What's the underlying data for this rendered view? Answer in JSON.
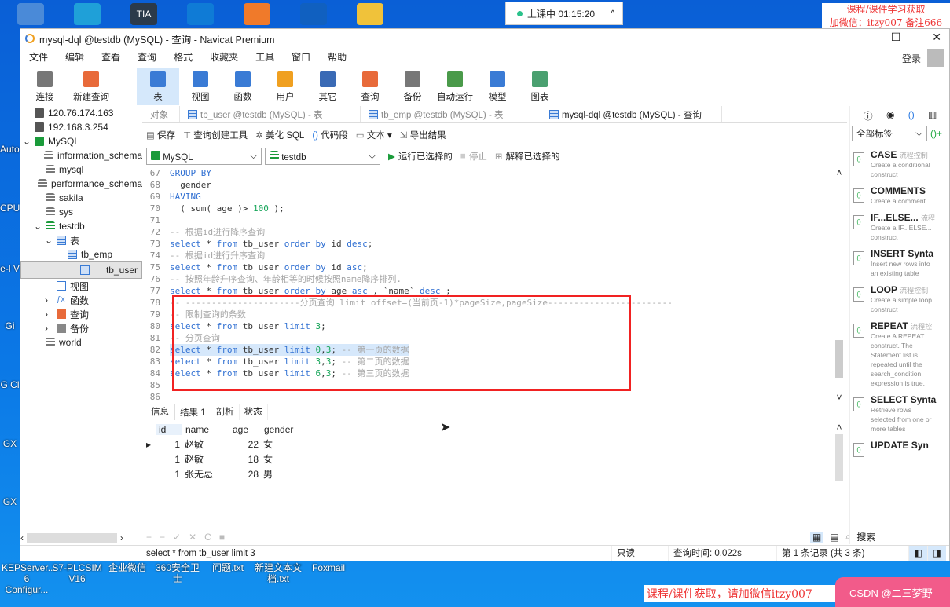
{
  "desktop": {
    "top_icons": [
      {
        "name": "computer",
        "color": "#4a8ad8"
      },
      {
        "name": "edge",
        "color": "#1fa0d8"
      },
      {
        "name": "tia-portal",
        "color": "#2b3a4a",
        "label": "TIA"
      },
      {
        "name": "app-a",
        "color": "#0f7bd6"
      },
      {
        "name": "app-colorful",
        "color": "#f07a2a"
      },
      {
        "name": "app-k",
        "color": "#1060c0"
      },
      {
        "name": "folder",
        "color": "#f0c23a"
      }
    ],
    "left_labels": [
      "Auto Lice",
      "CPU 设",
      "e-l V",
      "Gi",
      "G Cl",
      "GX",
      "GX"
    ],
    "bottom_labels": [
      "KEPServer... 6 Configur...",
      "S7-PLCSIM V16",
      "企业微信",
      "360安全卫士",
      "问题.txt",
      "新建文本文档.txt",
      "Foxmail"
    ],
    "timer": "上课中 01:15:20",
    "watermark_top": [
      "课程/课件学习获取",
      "加微信：itzy007 备注666"
    ],
    "watermark_bottom": "课程/课件获取，请加微信itzy007",
    "badge": "CSDN @二三梦野"
  },
  "window": {
    "title": "mysql-dql @testdb (MySQL) - 查询 - Navicat Premium",
    "login": "登录"
  },
  "menu": [
    "文件",
    "编辑",
    "查看",
    "查询",
    "格式",
    "收藏夹",
    "工具",
    "窗口",
    "帮助"
  ],
  "toolbar": [
    {
      "label": "连接",
      "color": "#777"
    },
    {
      "label": "新建查询",
      "color": "#e86a3a"
    },
    {
      "label": "表",
      "color": "#3a7bd5",
      "active": true
    },
    {
      "label": "视图",
      "color": "#3a7bd5"
    },
    {
      "label": "函数",
      "color": "#3a7bd5"
    },
    {
      "label": "用户",
      "color": "#f0a020"
    },
    {
      "label": "其它",
      "color": "#3a6ab5"
    },
    {
      "label": "查询",
      "color": "#e86a3a"
    },
    {
      "label": "备份",
      "color": "#777"
    },
    {
      "label": "自动运行",
      "color": "#4a9a4a"
    },
    {
      "label": "模型",
      "color": "#3a7bd5"
    },
    {
      "label": "图表",
      "color": "#4aa070"
    }
  ],
  "tree": [
    {
      "label": "120.76.174.163",
      "indent": 0,
      "icon": "conn"
    },
    {
      "label": "192.168.3.254",
      "indent": 0,
      "icon": "conn"
    },
    {
      "label": "MySQL",
      "indent": 0,
      "icon": "conn-green",
      "arrow": "v"
    },
    {
      "label": "information_schema",
      "indent": 1,
      "icon": "db"
    },
    {
      "label": "mysql",
      "indent": 1,
      "icon": "db"
    },
    {
      "label": "performance_schema",
      "indent": 1,
      "icon": "db"
    },
    {
      "label": "sakila",
      "indent": 1,
      "icon": "db"
    },
    {
      "label": "sys",
      "indent": 1,
      "icon": "db"
    },
    {
      "label": "testdb",
      "indent": 1,
      "icon": "db-green",
      "arrow": "v"
    },
    {
      "label": "表",
      "indent": 2,
      "icon": "table",
      "arrow": "v"
    },
    {
      "label": "tb_emp",
      "indent": 3,
      "icon": "table"
    },
    {
      "label": "tb_user",
      "indent": 3,
      "icon": "table",
      "selected": true
    },
    {
      "label": "视图",
      "indent": 2,
      "icon": "view"
    },
    {
      "label": "函数",
      "indent": 2,
      "icon": "fx",
      "arrow": ">"
    },
    {
      "label": "查询",
      "indent": 2,
      "icon": "query",
      "arrow": ">"
    },
    {
      "label": "备份",
      "indent": 2,
      "icon": "backup",
      "arrow": ">"
    },
    {
      "label": "world",
      "indent": 1,
      "icon": "db"
    }
  ],
  "tabs": [
    {
      "label": "对象"
    },
    {
      "label": "tb_user @testdb (MySQL) - 表"
    },
    {
      "label": "tb_emp @testdb (MySQL) - 表"
    },
    {
      "label": "mysql-dql @testdb (MySQL) - 查询",
      "active": true
    }
  ],
  "query_toolbar": [
    "保存",
    "查询创建工具",
    "美化 SQL",
    "代码段",
    "文本 ▾",
    "导出结果"
  ],
  "connection_select": "MySQL",
  "database_select": "testdb",
  "run_buttons": [
    "运行已选择的",
    "停止",
    "解释已选择的"
  ],
  "code": [
    {
      "n": "67",
      "t": [
        [
          "k",
          "GROUP BY"
        ]
      ]
    },
    {
      "n": "68",
      "t": [
        [
          "tx",
          "  gender"
        ]
      ]
    },
    {
      "n": "69",
      "t": [
        [
          "k",
          "HAVING"
        ]
      ]
    },
    {
      "n": "70",
      "t": [
        [
          "tx",
          "  ( sum( age )> "
        ],
        [
          "num",
          "100"
        ],
        [
          "tx",
          " );"
        ]
      ]
    },
    {
      "n": "71",
      "t": []
    },
    {
      "n": "72",
      "t": [
        [
          "cm",
          "-- 根据id进行降序查询"
        ]
      ]
    },
    {
      "n": "73",
      "t": [
        [
          "k",
          "select"
        ],
        [
          "tx",
          " * "
        ],
        [
          "k",
          "from"
        ],
        [
          "tx",
          " tb_user "
        ],
        [
          "k",
          "order by"
        ],
        [
          "tx",
          " id "
        ],
        [
          "k",
          "desc"
        ],
        [
          "tx",
          ";"
        ]
      ]
    },
    {
      "n": "74",
      "t": [
        [
          "cm",
          "-- 根据id进行升序查询"
        ]
      ]
    },
    {
      "n": "75",
      "t": [
        [
          "k",
          "select"
        ],
        [
          "tx",
          " * "
        ],
        [
          "k",
          "from"
        ],
        [
          "tx",
          " tb_user "
        ],
        [
          "k",
          "order by"
        ],
        [
          "tx",
          " id "
        ],
        [
          "k",
          "asc"
        ],
        [
          "tx",
          ";"
        ]
      ]
    },
    {
      "n": "76",
      "t": [
        [
          "cm",
          "-- 按照年龄升序查询、年龄相等的时候按照name降序排列."
        ]
      ]
    },
    {
      "n": "77",
      "t": [
        [
          "k",
          "select"
        ],
        [
          "tx",
          " * "
        ],
        [
          "k",
          "from"
        ],
        [
          "tx",
          " tb_user "
        ],
        [
          "k",
          "order by"
        ],
        [
          "tx",
          " age "
        ],
        [
          "k",
          "asc"
        ],
        [
          "tx",
          " , `name` "
        ],
        [
          "k",
          "desc"
        ],
        [
          "tx",
          " ;"
        ]
      ]
    },
    {
      "n": "78",
      "t": [
        [
          "cm",
          "-- ----------------------分页查询 limit offset=(当前页-1)*pageSize,pageSize------------------------"
        ]
      ]
    },
    {
      "n": "79",
      "t": [
        [
          "cm",
          "-- 限制查询的条数"
        ]
      ]
    },
    {
      "n": "80",
      "t": [
        [
          "k",
          "select"
        ],
        [
          "tx",
          " * "
        ],
        [
          "k",
          "from"
        ],
        [
          "tx",
          " tb_user "
        ],
        [
          "k",
          "limit"
        ],
        [
          "tx",
          " "
        ],
        [
          "num",
          "3"
        ],
        [
          "tx",
          ";"
        ]
      ]
    },
    {
      "n": "81",
      "t": [
        [
          "cm",
          "-- 分页查询"
        ]
      ]
    },
    {
      "n": "82",
      "hl": true,
      "t": [
        [
          "k",
          "select"
        ],
        [
          "tx",
          " * "
        ],
        [
          "k",
          "from"
        ],
        [
          "tx",
          " tb_user "
        ],
        [
          "k",
          "limit"
        ],
        [
          "tx",
          " "
        ],
        [
          "num",
          "0"
        ],
        [
          "tx",
          ","
        ],
        [
          "num",
          "3"
        ],
        [
          "tx",
          "; "
        ],
        [
          "cm",
          "-- 第一页的数据"
        ]
      ]
    },
    {
      "n": "83",
      "t": [
        [
          "k",
          "select"
        ],
        [
          "tx",
          " * "
        ],
        [
          "k",
          "from"
        ],
        [
          "tx",
          " tb_user "
        ],
        [
          "k",
          "limit"
        ],
        [
          "tx",
          " "
        ],
        [
          "num",
          "3"
        ],
        [
          "tx",
          ","
        ],
        [
          "num",
          "3"
        ],
        [
          "tx",
          "; "
        ],
        [
          "cm",
          "-- 第二页的数据"
        ]
      ]
    },
    {
      "n": "84",
      "t": [
        [
          "k",
          "select"
        ],
        [
          "tx",
          " * "
        ],
        [
          "k",
          "from"
        ],
        [
          "tx",
          " tb_user "
        ],
        [
          "k",
          "limit"
        ],
        [
          "tx",
          " "
        ],
        [
          "num",
          "6"
        ],
        [
          "tx",
          ","
        ],
        [
          "num",
          "3"
        ],
        [
          "tx",
          "; "
        ],
        [
          "cm",
          "-- 第三页的数据"
        ]
      ]
    },
    {
      "n": "85",
      "t": []
    },
    {
      "n": "86",
      "t": []
    }
  ],
  "result_tabs": [
    "信息",
    "结果 1",
    "剖析",
    "状态"
  ],
  "result": {
    "columns": [
      "id",
      "name",
      "age",
      "gender"
    ],
    "rows": [
      [
        "1",
        "赵敏",
        "22",
        "女"
      ],
      [
        "1",
        "赵敏",
        "18",
        "女"
      ],
      [
        "1",
        "张无忌",
        "28",
        "男"
      ]
    ]
  },
  "grid_tools": [
    "+",
    "−",
    "✓",
    "✕",
    "C",
    "■"
  ],
  "status": {
    "sql": "select * from tb_user limit 3",
    "mode": "只读",
    "time": "查询时间: 0.022s",
    "record": "第 1 条记录 (共 3 条)"
  },
  "right_panel": {
    "filter": "全部标签",
    "search": "搜索",
    "snippets": [
      {
        "title": "CASE",
        "tag": "流程控制",
        "desc": "Create a conditional construct"
      },
      {
        "title": "COMMENTS",
        "tag": "",
        "desc": "Create a comment"
      },
      {
        "title": "IF...ELSE...",
        "tag": "流程",
        "desc": "Create a IF...ELSE... construct"
      },
      {
        "title": "INSERT Synta",
        "tag": "",
        "desc": "Insert new rows into an existing table"
      },
      {
        "title": "LOOP",
        "tag": "流程控制",
        "desc": "Create a simple loop construct"
      },
      {
        "title": "REPEAT",
        "tag": "流程控",
        "desc": "Create A REPEAT construct. The Statement list is repeated until the search_condition expression is true."
      },
      {
        "title": "SELECT Synta",
        "tag": "",
        "desc": "Retrieve rows selected from one or more tables"
      },
      {
        "title": "UPDATE Syn",
        "tag": "",
        "desc": ""
      }
    ]
  }
}
